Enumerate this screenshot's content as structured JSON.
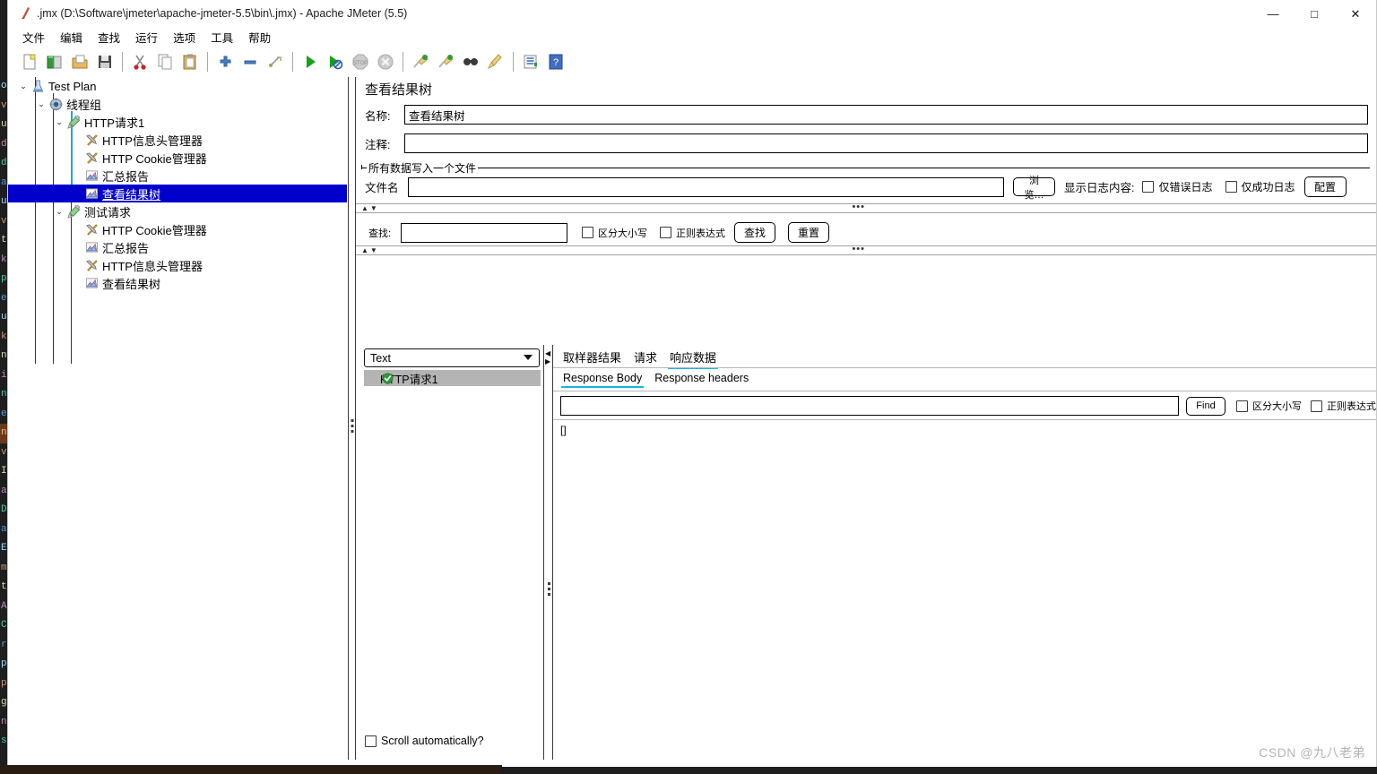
{
  "window": {
    "title": ".jmx (D:\\Software\\jmeter\\apache-jmeter-5.5\\bin\\.jmx) - Apache JMeter (5.5)",
    "app_icon": "jmeter-feather-icon",
    "minimize": "—",
    "maximize": "□",
    "close": "✕"
  },
  "menubar": {
    "items": [
      {
        "label": "文件"
      },
      {
        "label": "编辑"
      },
      {
        "label": "查找"
      },
      {
        "label": "运行"
      },
      {
        "label": "选项"
      },
      {
        "label": "工具"
      },
      {
        "label": "帮助"
      }
    ]
  },
  "toolbar": {
    "buttons": [
      {
        "name": "new-icon",
        "glyph": "🗋"
      },
      {
        "name": "templates-icon",
        "glyph": "📚"
      },
      {
        "name": "open-icon",
        "glyph": "📂"
      },
      {
        "name": "save-icon",
        "glyph": "💾"
      },
      {
        "name": "separator-1",
        "glyph": "|"
      },
      {
        "name": "cut-icon",
        "glyph": "✂"
      },
      {
        "name": "copy-icon",
        "glyph": "⧉"
      },
      {
        "name": "paste-icon",
        "glyph": "📋"
      },
      {
        "name": "separator-2",
        "glyph": "|"
      },
      {
        "name": "expand-all-icon",
        "glyph": "＋"
      },
      {
        "name": "collapse-all-icon",
        "glyph": "－"
      },
      {
        "name": "toggle-icon",
        "glyph": "⤵"
      },
      {
        "name": "separator-3",
        "glyph": "|"
      },
      {
        "name": "start-icon",
        "glyph": "▶"
      },
      {
        "name": "start-no-pauses-icon",
        "glyph": "▷"
      },
      {
        "name": "stop-icon",
        "glyph": "⬣"
      },
      {
        "name": "shutdown-icon",
        "glyph": "✖"
      },
      {
        "name": "separator-4",
        "glyph": "|"
      },
      {
        "name": "clear-icon",
        "glyph": "🧹"
      },
      {
        "name": "clear-all-icon",
        "glyph": "🧹"
      },
      {
        "name": "search-icon",
        "glyph": "🔎"
      },
      {
        "name": "reset-search-icon",
        "glyph": "🧹"
      },
      {
        "name": "separator-5",
        "glyph": "|"
      },
      {
        "name": "function-helper-icon",
        "glyph": "≣"
      },
      {
        "name": "help-icon",
        "glyph": "?"
      }
    ]
  },
  "tree": {
    "nodes": [
      {
        "label": "Test Plan",
        "depth": 0,
        "twisty": "⌄",
        "icon": "test-plan-icon",
        "selected": false
      },
      {
        "label": "线程组",
        "depth": 1,
        "twisty": "⌄",
        "icon": "thread-group-icon",
        "selected": false
      },
      {
        "label": "HTTP请求1",
        "depth": 2,
        "twisty": "⌄",
        "icon": "http-sampler-icon",
        "selected": false
      },
      {
        "label": "HTTP信息头管理器",
        "depth": 3,
        "twisty": "",
        "icon": "config-element-icon",
        "selected": false
      },
      {
        "label": "HTTP Cookie管理器",
        "depth": 3,
        "twisty": "",
        "icon": "config-element-icon",
        "selected": false
      },
      {
        "label": "汇总报告",
        "depth": 3,
        "twisty": "",
        "icon": "listener-icon",
        "selected": false
      },
      {
        "label": "查看结果树",
        "depth": 3,
        "twisty": "",
        "icon": "listener-icon",
        "selected": true
      },
      {
        "label": "测试请求",
        "depth": 2,
        "twisty": "⌄",
        "icon": "http-sampler-icon",
        "selected": false
      },
      {
        "label": "HTTP Cookie管理器",
        "depth": 3,
        "twisty": "",
        "icon": "config-element-icon",
        "selected": false
      },
      {
        "label": "汇总报告",
        "depth": 3,
        "twisty": "",
        "icon": "listener-icon",
        "selected": false
      },
      {
        "label": "HTTP信息头管理器",
        "depth": 3,
        "twisty": "",
        "icon": "config-element-icon",
        "selected": false
      },
      {
        "label": "查看结果树",
        "depth": 3,
        "twisty": "",
        "icon": "listener-icon",
        "selected": false
      }
    ]
  },
  "panel": {
    "title": "查看结果树",
    "name_label": "名称:",
    "name_value": "查看结果树",
    "comment_label": "注释:",
    "comment_value": "",
    "group_legend": "所有数据写入一个文件",
    "filename_label": "文件名",
    "filename_value": "",
    "browse_label": "浏览…",
    "log_display_label": "显示日志内容:",
    "errors_only_label": "仅错误日志",
    "errors_only_checked": false,
    "success_only_label": "仅成功日志",
    "success_only_checked": false,
    "configure_label": "配置"
  },
  "search": {
    "label": "查找:",
    "value": "",
    "case_sensitive_label": "区分大小写",
    "case_sensitive_checked": false,
    "regex_label": "正则表达式",
    "regex_checked": false,
    "find_button": "查找",
    "reset_button": "重置"
  },
  "splitter": {
    "up_arrow": "▲",
    "down_arrow": "▼",
    "dots": "•••"
  },
  "results": {
    "renderer_selected": "Text",
    "renderer_caret": "chevron-down-icon",
    "items": [
      {
        "label": "HTTP请求1",
        "status": "success",
        "icon": "success-shield-icon"
      }
    ],
    "scroll_auto_label": "Scroll automatically?",
    "scroll_auto_checked": false
  },
  "detail": {
    "main_tabs": [
      {
        "label": "取样器结果",
        "active": false
      },
      {
        "label": "请求",
        "active": false
      },
      {
        "label": "响应数据",
        "active": true
      }
    ],
    "sub_tabs": [
      {
        "label": "Response Body",
        "active": true
      },
      {
        "label": "Response headers",
        "active": false
      }
    ],
    "find_value": "",
    "find_button": "Find",
    "case_sensitive_label": "区分大小写",
    "case_sensitive_checked": false,
    "regex_label": "正则表达式",
    "regex_checked": false,
    "response_body": "[]"
  },
  "watermark": {
    "text": "CSDN @九八老弟"
  },
  "colors": {
    "selection_blue": "#0000CD",
    "tab_underline_cyan": "#17B4E0",
    "tree_guide_cyan": "#17A9D6",
    "result_row_gray": "#B4B4B4",
    "watermark_gray": "#B4B4B4"
  },
  "background_editor": {
    "fragments": [
      "o-",
      "va",
      "ue",
      "d",
      "d",
      "al",
      "ue",
      "va",
      "te",
      "k/",
      "p",
      "ei",
      "ue",
      "k/",
      "ne",
      "is",
      "ne",
      "es",
      "ne",
      "va",
      "ID",
      "at",
      "Di",
      "at",
      "En",
      "m",
      "t_",
      "Au",
      "C.",
      "rl",
      "ps",
      "ps",
      "g",
      "n_",
      "sg"
    ]
  }
}
